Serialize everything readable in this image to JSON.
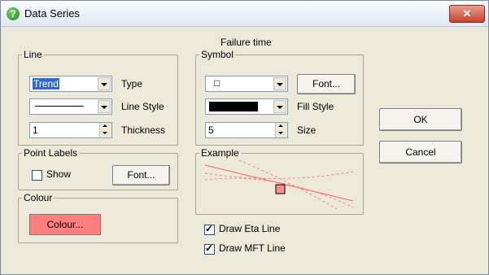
{
  "window": {
    "title": "Data Series",
    "close_label": "✕",
    "help_icon": "help-icon"
  },
  "subtitle": "Failure time",
  "line": {
    "legend": "Line",
    "type_value": "Trend",
    "type_label": "Type",
    "line_style_label": "Line Style",
    "thickness_value": "1",
    "thickness_label": "Thickness"
  },
  "point_labels": {
    "legend": "Point Labels",
    "show_label": "Show",
    "show_checked": false,
    "font_label": "Font..."
  },
  "colour": {
    "legend": "Colour",
    "button_label": "Colour...",
    "swatch_color": "#ff7f7f"
  },
  "symbol": {
    "legend": "Symbol",
    "symbol_value": "□",
    "font_label": "Font...",
    "fill_style_label": "Fill Style",
    "fill_color": "#000000",
    "size_value": "5",
    "size_label": "Size"
  },
  "example": {
    "legend": "Example",
    "line_color": "#ff6060"
  },
  "checks": [
    {
      "label": "Draw Eta Line",
      "checked": true
    },
    {
      "label": "Draw MFT Line",
      "checked": true
    }
  ],
  "buttons": {
    "ok": "OK",
    "cancel": "Cancel"
  }
}
